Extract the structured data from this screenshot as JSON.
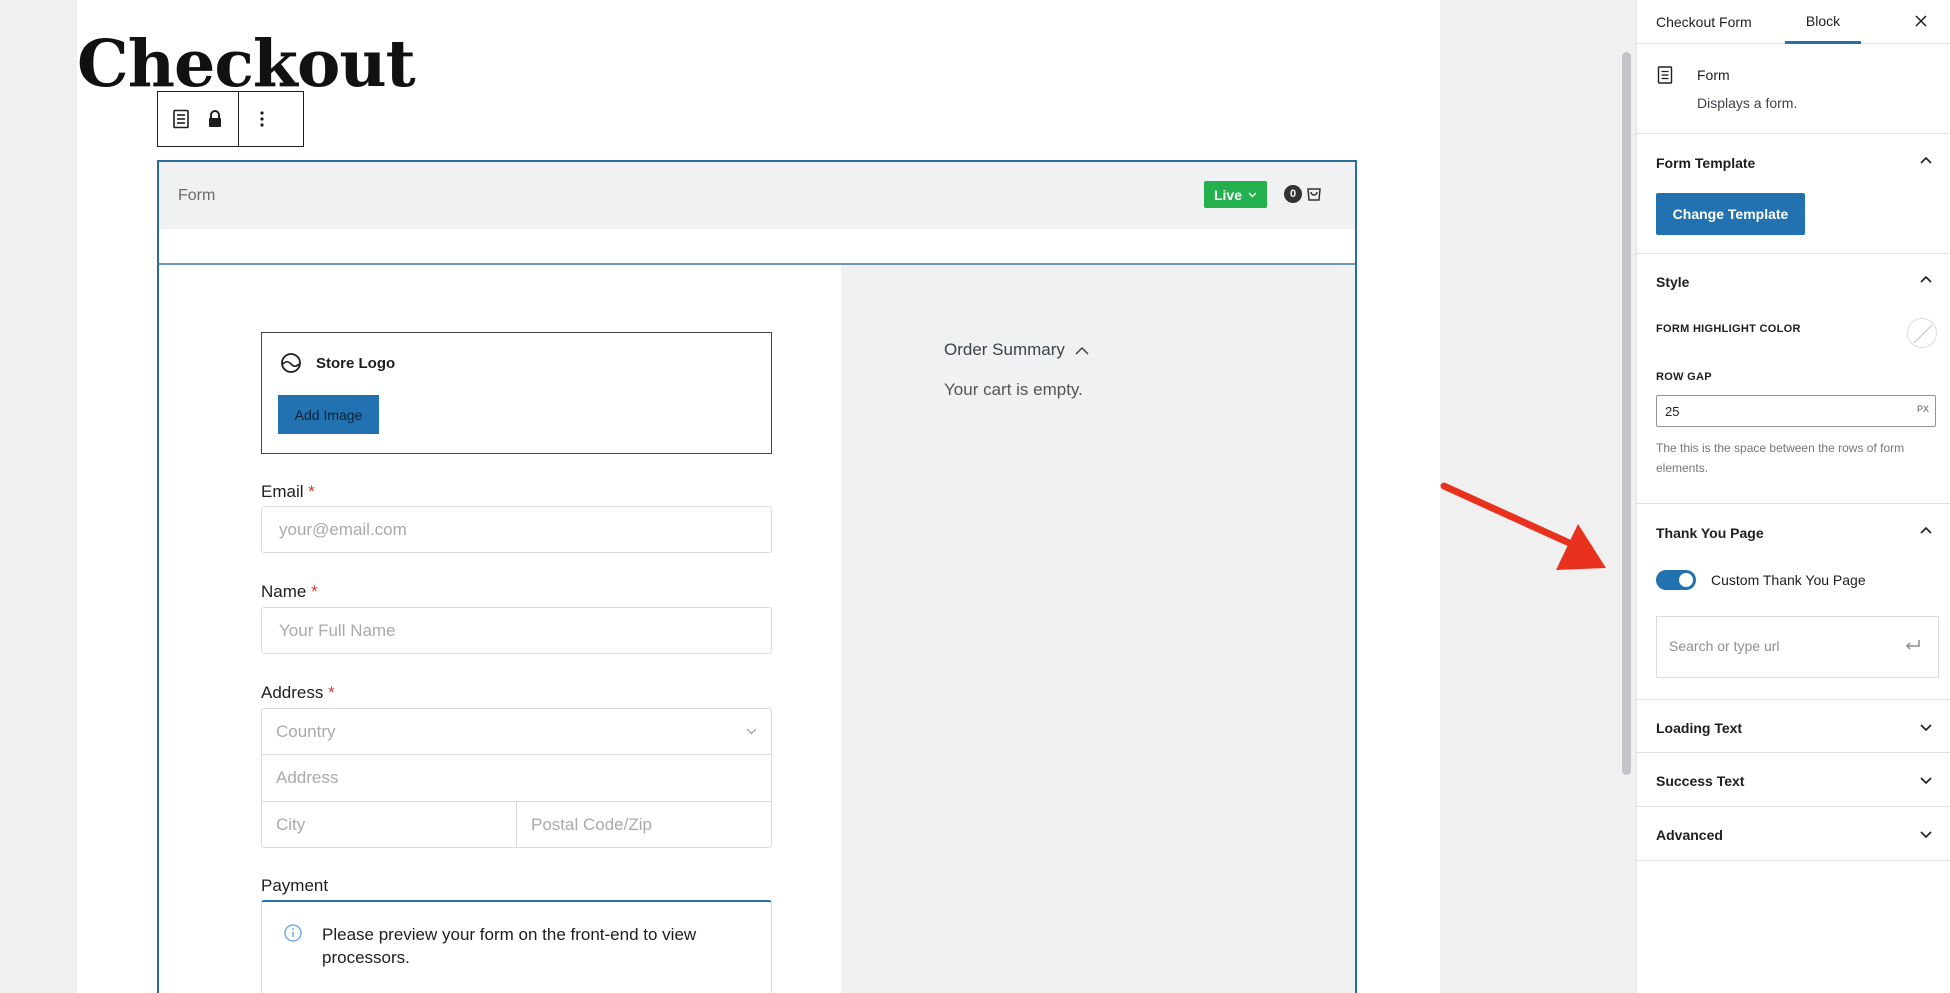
{
  "page": {
    "title": "Checkout"
  },
  "form_block": {
    "header_label": "Form",
    "live_label": "Live",
    "cart_count": "0",
    "store_logo_label": "Store Logo",
    "add_image_label": "Add Image",
    "email": {
      "label": "Email",
      "required": "*",
      "placeholder": "your@email.com"
    },
    "name": {
      "label": "Name",
      "required": "*",
      "placeholder": "Your Full Name"
    },
    "address": {
      "label": "Address",
      "required": "*",
      "country_placeholder": "Country",
      "address_placeholder": "Address",
      "city_placeholder": "City",
      "postal_placeholder": "Postal Code/Zip"
    },
    "payment": {
      "label": "Payment",
      "notice": "Please preview your form on the front-end to view processors."
    },
    "order_summary": {
      "title": "Order Summary",
      "empty_text": "Your cart is empty."
    }
  },
  "sidebar": {
    "tabs": [
      {
        "label": "Checkout Form",
        "active": false
      },
      {
        "label": "Block",
        "active": true
      }
    ],
    "block_card": {
      "title": "Form",
      "description": "Displays a form."
    },
    "form_template": {
      "title": "Form Template",
      "button_label": "Change Template"
    },
    "style": {
      "title": "Style",
      "highlight_label": "FORM HIGHLIGHT COLOR",
      "row_gap_label": "ROW GAP",
      "row_gap_value": "25",
      "row_gap_unit": "PX",
      "help_text": "The this is the space between the rows of form elements."
    },
    "thank_you": {
      "title": "Thank You Page",
      "toggle_label": "Custom Thank You Page",
      "toggle_on": true,
      "url_placeholder": "Search or type url"
    },
    "collapsed_panels": [
      {
        "title": "Loading Text"
      },
      {
        "title": "Success Text"
      },
      {
        "title": "Advanced"
      }
    ]
  },
  "colors": {
    "accent": "#2271b1",
    "live_green": "#22b14c",
    "required_red": "#d63638",
    "annotation_red": "#e8321e"
  }
}
